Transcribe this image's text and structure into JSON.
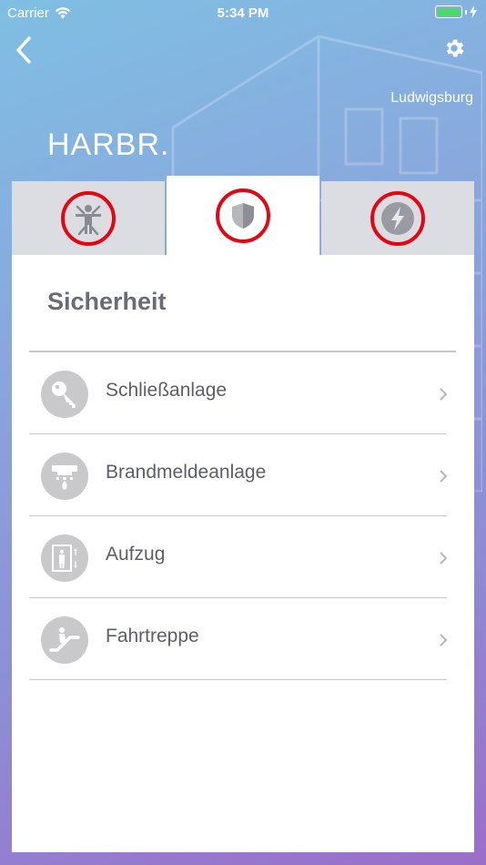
{
  "status_bar": {
    "carrier": "Carrier",
    "time": "5:34 PM"
  },
  "header": {
    "location": "Ludwigsburg",
    "title": "HARBR."
  },
  "tabs": [
    {
      "icon": "vitruvian-man-icon",
      "active": false
    },
    {
      "icon": "shield-icon",
      "active": true
    },
    {
      "icon": "lightning-icon",
      "active": false
    }
  ],
  "panel": {
    "title": "Sicherheit",
    "items": [
      {
        "label": "Schließanlage",
        "icon": "key-icon"
      },
      {
        "label": "Brandmeldeanlage",
        "icon": "smoke-detector-icon"
      },
      {
        "label": "Aufzug",
        "icon": "elevator-icon"
      },
      {
        "label": "Fahrtreppe",
        "icon": "escalator-icon"
      }
    ]
  },
  "colors": {
    "highlight_ring": "#e30613",
    "battery": "#4cd964",
    "icon_grey": "#c9c9cc"
  }
}
